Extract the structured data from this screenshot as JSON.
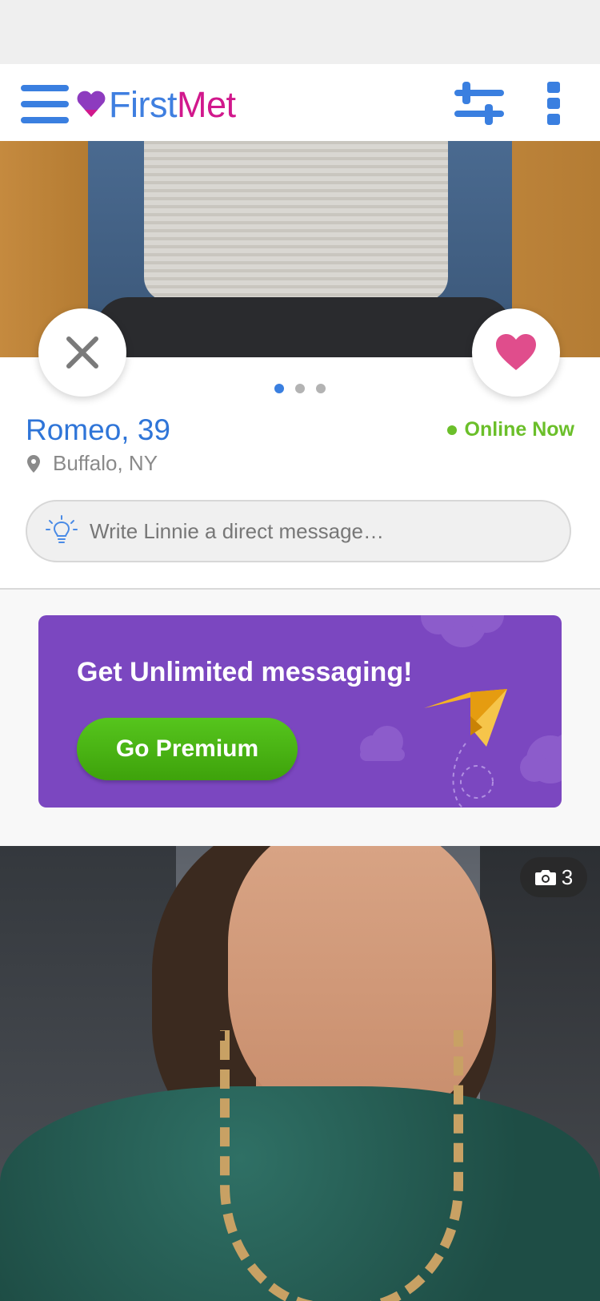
{
  "app": {
    "logo_first": "First",
    "logo_met": "Met",
    "accent_color": "#3a7fe0",
    "brand_color": "#d1188c"
  },
  "header": {
    "menu_icon": "hamburger-menu-icon",
    "filter_icon": "sliders-icon",
    "more_icon": "more-vertical-icon"
  },
  "profile": {
    "name_age": "Romeo, 39",
    "status": "Online Now",
    "location": "Buffalo, NY",
    "photo_page_index": 1,
    "photo_page_count": 3
  },
  "actions": {
    "pass_icon": "close-icon",
    "like_icon": "heart-icon"
  },
  "message": {
    "placeholder": "Write Linnie a direct message…",
    "value": ""
  },
  "promo": {
    "title": "Get Unlimited messaging!",
    "button_label": "Go Premium"
  },
  "next_profile": {
    "photo_count": "3"
  }
}
